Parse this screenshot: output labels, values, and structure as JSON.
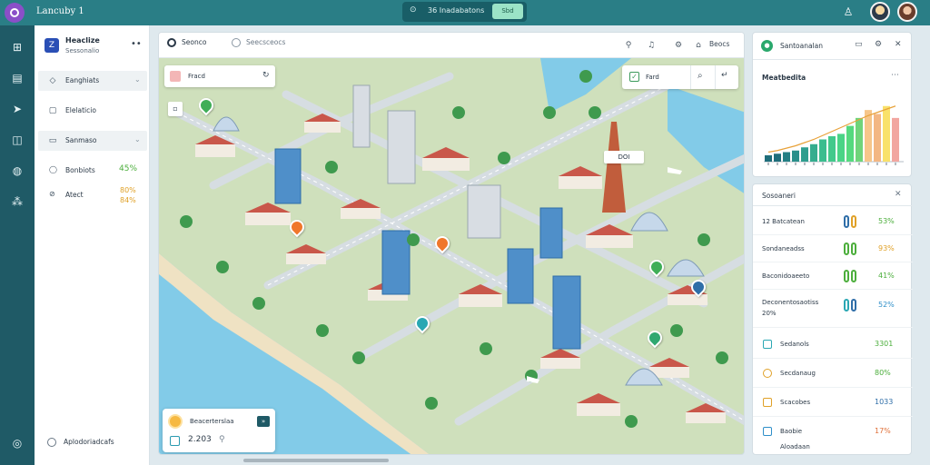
{
  "topbar": {
    "app_title": "Lancuby 1",
    "center_text": "36 Inadabatons",
    "center_badge": "Sbd"
  },
  "sidebar": {
    "title": "Heaclize",
    "subtitle": "Sessonalio",
    "items": [
      {
        "label": "Eanghiats"
      },
      {
        "label": "Elelaticio"
      },
      {
        "label": "Sanmaso"
      }
    ],
    "stats": [
      {
        "label": "Bonbiots",
        "value": "45%"
      },
      {
        "label": "Atect",
        "value": "80%",
        "value2": "84%"
      }
    ],
    "footer": "Aplodoriadcafs"
  },
  "toolbar": {
    "tab_active": "Seonco",
    "tab_inactive": "Seecsceocs",
    "tool_label": "Beocs"
  },
  "map": {
    "search_text": "Fracd",
    "filter_text": "Fard",
    "pin_label": "DOI",
    "card_title": "Beacerterslaa",
    "card_value": "2.203"
  },
  "chart_panel": {
    "title": "Santoanalan",
    "sub_title": "Meatbedita"
  },
  "chart_data": {
    "type": "bar",
    "series": [
      {
        "values": [
          8,
          10,
          12,
          14,
          18,
          22,
          28,
          32,
          35,
          45,
          55,
          65,
          60,
          70,
          55
        ]
      }
    ],
    "trend": [
      12,
      14,
      17,
      20,
      24,
      28,
      33,
      38,
      43,
      48,
      53,
      58,
      62,
      66,
      70
    ],
    "ylim": [
      0,
      80
    ]
  },
  "list_panel": {
    "title": "Sosoaneri",
    "rows": [
      {
        "label": "12 Batcatean",
        "value": "53%"
      },
      {
        "label": "Sondaneadss",
        "value": "93%"
      },
      {
        "label": "Baconidoaeeto",
        "value": "41%"
      },
      {
        "label": "Deconentosaotiss",
        "label2": "20%",
        "value": "52%"
      }
    ],
    "icon_rows": [
      {
        "label": "Sedanols",
        "value": "3301"
      },
      {
        "label": "Secdanaug",
        "value": "80%"
      },
      {
        "label": "Scacobes",
        "value": "1033"
      },
      {
        "label": "Baobie",
        "label2": "Aloadaan",
        "value": "17%"
      }
    ]
  },
  "colors": {
    "accent": "#2a7e86",
    "rail": "#1f5a66",
    "positive": "#4cae3c",
    "water": "#82cbe8"
  }
}
